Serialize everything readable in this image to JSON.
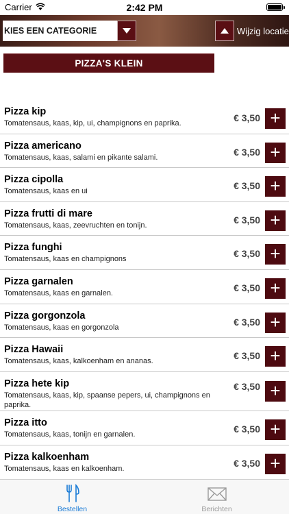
{
  "status_bar": {
    "carrier": "Carrier",
    "time": "2:42 PM",
    "battery_level": 1.0
  },
  "header": {
    "category_select": "KIES EEN CATEGORIE",
    "location_button": "Wijzig locatie"
  },
  "section_title": "PIZZA'S KLEIN",
  "items": [
    {
      "name": "Pizza kip",
      "desc": "Tomatensaus, kaas, kip, ui, champignons en paprika.",
      "price": "€ 3,50",
      "add": "+"
    },
    {
      "name": "Pizza americano",
      "desc": "Tomatensaus, kaas, salami en pikante salami.",
      "price": "€ 3,50",
      "add": "+"
    },
    {
      "name": "Pizza cipolla",
      "desc": "Tomatensaus, kaas en ui",
      "price": "€ 3,50",
      "add": "+"
    },
    {
      "name": "Pizza frutti di mare",
      "desc": "Tomatensaus, kaas, zeevruchten en tonijn.",
      "price": "€ 3,50",
      "add": "+"
    },
    {
      "name": "Pizza funghi",
      "desc": "Tomatensaus, kaas en champignons",
      "price": "€ 3,50",
      "add": "+"
    },
    {
      "name": "Pizza garnalen",
      "desc": "Tomatensaus, kaas en garnalen.",
      "price": "€ 3,50",
      "add": "+"
    },
    {
      "name": "Pizza gorgonzola",
      "desc": "Tomatensaus, kaas en gorgonzola",
      "price": "€ 3,50",
      "add": "+"
    },
    {
      "name": "Pizza Hawaii",
      "desc": "Tomatensaus, kaas, kalkoenham en ananas.",
      "price": "€ 3,50",
      "add": "+"
    },
    {
      "name": "Pizza hete kip",
      "desc": "Tomatensaus, kaas, kip, spaanse pepers, ui, champignons en paprika.",
      "price": "€ 3,50",
      "add": "+"
    },
    {
      "name": "Pizza itto",
      "desc": "Tomatensaus, kaas, tonijn en garnalen.",
      "price": "€ 3,50",
      "add": "+"
    },
    {
      "name": "Pizza kalkoenham",
      "desc": "Tomatensaus, kaas en kalkoenham.",
      "price": "€ 3,50",
      "add": "+"
    }
  ],
  "tabs": [
    {
      "label": "Bestellen",
      "icon": "fork-knife-icon",
      "active": true
    },
    {
      "label": "Berichten",
      "icon": "envelope-icon",
      "active": false
    }
  ],
  "colors": {
    "accent": "#5b0f14",
    "tab_active": "#1a7bd6",
    "tab_inactive": "#9a9a9a"
  }
}
